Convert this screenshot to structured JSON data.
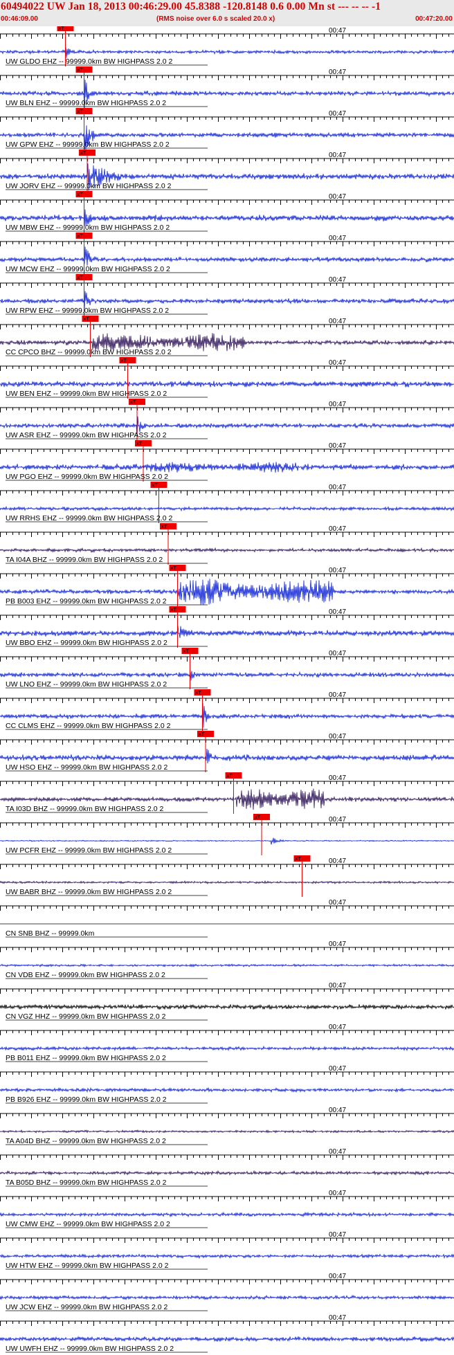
{
  "header": {
    "title": "60494022 UW Jan 18, 2013 00:46:29.00   45.8388 -120.8148  0.6 0.00 Mn st --- -- --   -1",
    "start_time": "00:46:09.00",
    "noise_note": "(RMS noise over 6.0 s scaled 20.0 x)",
    "end_time": "00:47:20.00"
  },
  "chart_data": {
    "type": "seismogram",
    "start_time": "00:46:09.00",
    "end_time": "00:47:20.00",
    "tick_label": "00:47",
    "pick_label": "xT",
    "colors": {
      "blue": "#0a1fd4",
      "dark": "#2a0f55",
      "black": "#000000",
      "pick": "#ee0000"
    },
    "traces": [
      {
        "label": "UW GLDO EHZ -- 99999.0km BW  HIGHPASS  2.0  2",
        "color": "blue",
        "noise": 3,
        "pick_s": 21,
        "event": {
          "s": 21,
          "dur": 3,
          "amp": 14
        }
      },
      {
        "label": "UW BLN EHZ -- 99999.0km BW  HIGHPASS  2.0  2",
        "color": "blue",
        "noise": 4,
        "pick_s": 27,
        "event": {
          "s": 27,
          "dur": 4,
          "amp": 26
        }
      },
      {
        "label": "UW GPW EHZ -- 99999.0km BW  HIGHPASS  2.0  2",
        "color": "blue",
        "noise": 4,
        "pick_s": 27,
        "event": {
          "s": 27,
          "dur": 6,
          "amp": 30
        }
      },
      {
        "label": "UW JORV EHZ -- 99999.0km BW  HIGHPASS  2.0  2",
        "color": "blue",
        "noise": 5,
        "pick_s": 28,
        "event": {
          "s": 28,
          "dur": 20,
          "amp": 22
        }
      },
      {
        "label": "UW MBW EHZ -- 99999.0km BW  HIGHPASS  2.0  2",
        "color": "blue",
        "noise": 5,
        "pick_s": 27,
        "event": {
          "s": 27,
          "dur": 4,
          "amp": 26
        }
      },
      {
        "label": "UW MCW EHZ -- 99999.0km BW  HIGHPASS  2.0  2",
        "color": "blue",
        "noise": 4,
        "pick_s": 27,
        "event": {
          "s": 27,
          "dur": 5,
          "amp": 26
        }
      },
      {
        "label": "UW RPW EHZ -- 99999.0km BW  HIGHPASS  2.0  2",
        "color": "blue",
        "noise": 4,
        "pick_s": 27,
        "event": {
          "s": 27,
          "dur": 5,
          "amp": 18
        }
      },
      {
        "label": "CC CPCO BHZ -- 99999.0km BW  HIGHPASS  2.0  2",
        "color": "dark",
        "noise": 4,
        "pick_s": 29,
        "event": {
          "s": 29,
          "dur": 50,
          "amp": 18
        }
      },
      {
        "label": "UW BEN EHZ -- 99999.0km BW  HIGHPASS  2.0  2",
        "color": "blue",
        "noise": 5,
        "pick_s": 41,
        "event": {
          "s": 41,
          "dur": 6,
          "amp": 10
        }
      },
      {
        "label": "UW ASR EHZ -- 99999.0km BW  HIGHPASS  2.0  2",
        "color": "blue",
        "noise": 4,
        "pick_s": 44,
        "event": {
          "s": 44,
          "dur": 4,
          "amp": 24
        }
      },
      {
        "label": "UW PGO EHZ -- 99999.0km BW  HIGHPASS  2.0  2",
        "color": "blue",
        "noise": 5,
        "pick_s": 46,
        "event": {
          "s": 46,
          "dur": 50,
          "amp": 10
        }
      },
      {
        "label": "UW RRHS EHZ -- 99999.0km BW  HIGHPASS  2.0  2",
        "color": "blue",
        "noise": 3,
        "pick_s": 51,
        "event": null
      },
      {
        "label": "TA I04A BHZ -- 99999.0km BW  HIGHPASS  2.0  2",
        "color": "dark",
        "noise": 3,
        "pick_s": 54,
        "event": null
      },
      {
        "label": "PB B003 EHZ -- 99999.0km BW  HIGHPASS  2.0  2",
        "color": "blue",
        "noise": 4,
        "pick_s": 57,
        "event": {
          "s": 57,
          "dur": 50,
          "amp": 24
        }
      },
      {
        "label": "UW BBO EHZ -- 99999.0km BW  HIGHPASS  2.0  2",
        "color": "blue",
        "noise": 5,
        "pick_s": 57,
        "event": {
          "s": 57,
          "dur": 8,
          "amp": 14
        }
      },
      {
        "label": "UW LNO EHZ -- 99999.0km BW  HIGHPASS  2.0  2",
        "color": "blue",
        "noise": 4,
        "pick_s": 61,
        "event": {
          "s": 61,
          "dur": 5,
          "amp": 10
        }
      },
      {
        "label": "CC CLMS EHZ -- 99999.0km BW  HIGHPASS  2.0  2",
        "color": "blue",
        "noise": 4,
        "pick_s": 65,
        "event": {
          "s": 65,
          "dur": 3,
          "amp": 26
        }
      },
      {
        "label": "UW HSO EHZ -- 99999.0km BW  HIGHPASS  2.0  2",
        "color": "blue",
        "noise": 5,
        "pick_s": 66,
        "event": {
          "s": 66,
          "dur": 3,
          "amp": 26
        }
      },
      {
        "label": "TA I03D BHZ -- 99999.0km BW  HIGHPASS  2.0  2",
        "color": "dark",
        "noise": 4,
        "pick_s": 75,
        "event": {
          "s": 76,
          "dur": 28,
          "amp": 20
        }
      },
      {
        "label": "UW PCFR EHZ -- 99999.0km BW  HIGHPASS  2.0  2",
        "color": "blue",
        "noise": 1,
        "pick_s": 84,
        "event": {
          "s": 87,
          "dur": 6,
          "amp": 6
        }
      },
      {
        "label": "UW BABR BHZ -- 99999.0km BW  HIGHPASS  2.0  2",
        "color": "dark",
        "noise": 2,
        "pick_s": 97,
        "event": null
      },
      {
        "label": "CN SNB BHZ -- 99999.0km",
        "color": "black",
        "noise": 0,
        "pick_s": null,
        "event": null
      },
      {
        "label": "CN VDB EHZ -- 99999.0km BW  HIGHPASS  2.0  2",
        "color": "blue",
        "noise": 2,
        "pick_s": null,
        "event": null
      },
      {
        "label": "CN VGZ HHZ -- 99999.0km BW  HIGHPASS  2.0  2",
        "color": "black",
        "noise": 4,
        "pick_s": null,
        "event": null
      },
      {
        "label": "PB B011 EHZ -- 99999.0km BW  HIGHPASS  2.0  2",
        "color": "blue",
        "noise": 3,
        "pick_s": null,
        "event": null
      },
      {
        "label": "PB B926 EHZ -- 99999.0km BW  HIGHPASS  2.0  2",
        "color": "blue",
        "noise": 3,
        "pick_s": null,
        "event": null
      },
      {
        "label": "TA A04D BHZ -- 99999.0km BW  HIGHPASS  2.0  2",
        "color": "dark",
        "noise": 2,
        "pick_s": null,
        "event": null
      },
      {
        "label": "TA B05D BHZ -- 99999.0km BW  HIGHPASS  2.0  2",
        "color": "dark",
        "noise": 3,
        "pick_s": null,
        "event": null
      },
      {
        "label": "UW CMW EHZ -- 99999.0km BW  HIGHPASS  2.0  2",
        "color": "blue",
        "noise": 3,
        "pick_s": null,
        "event": null
      },
      {
        "label": "UW HTW EHZ -- 99999.0km BW  HIGHPASS  2.0  2",
        "color": "blue",
        "noise": 3,
        "pick_s": null,
        "event": null
      },
      {
        "label": "UW JCW EHZ -- 99999.0km BW  HIGHPASS  2.0  2",
        "color": "blue",
        "noise": 3,
        "pick_s": null,
        "event": null
      },
      {
        "label": "UW UWFH EHZ -- 99999.0km BW  HIGHPASS  2.0  2",
        "color": "blue",
        "noise": 4,
        "pick_s": null,
        "event": null
      }
    ]
  }
}
